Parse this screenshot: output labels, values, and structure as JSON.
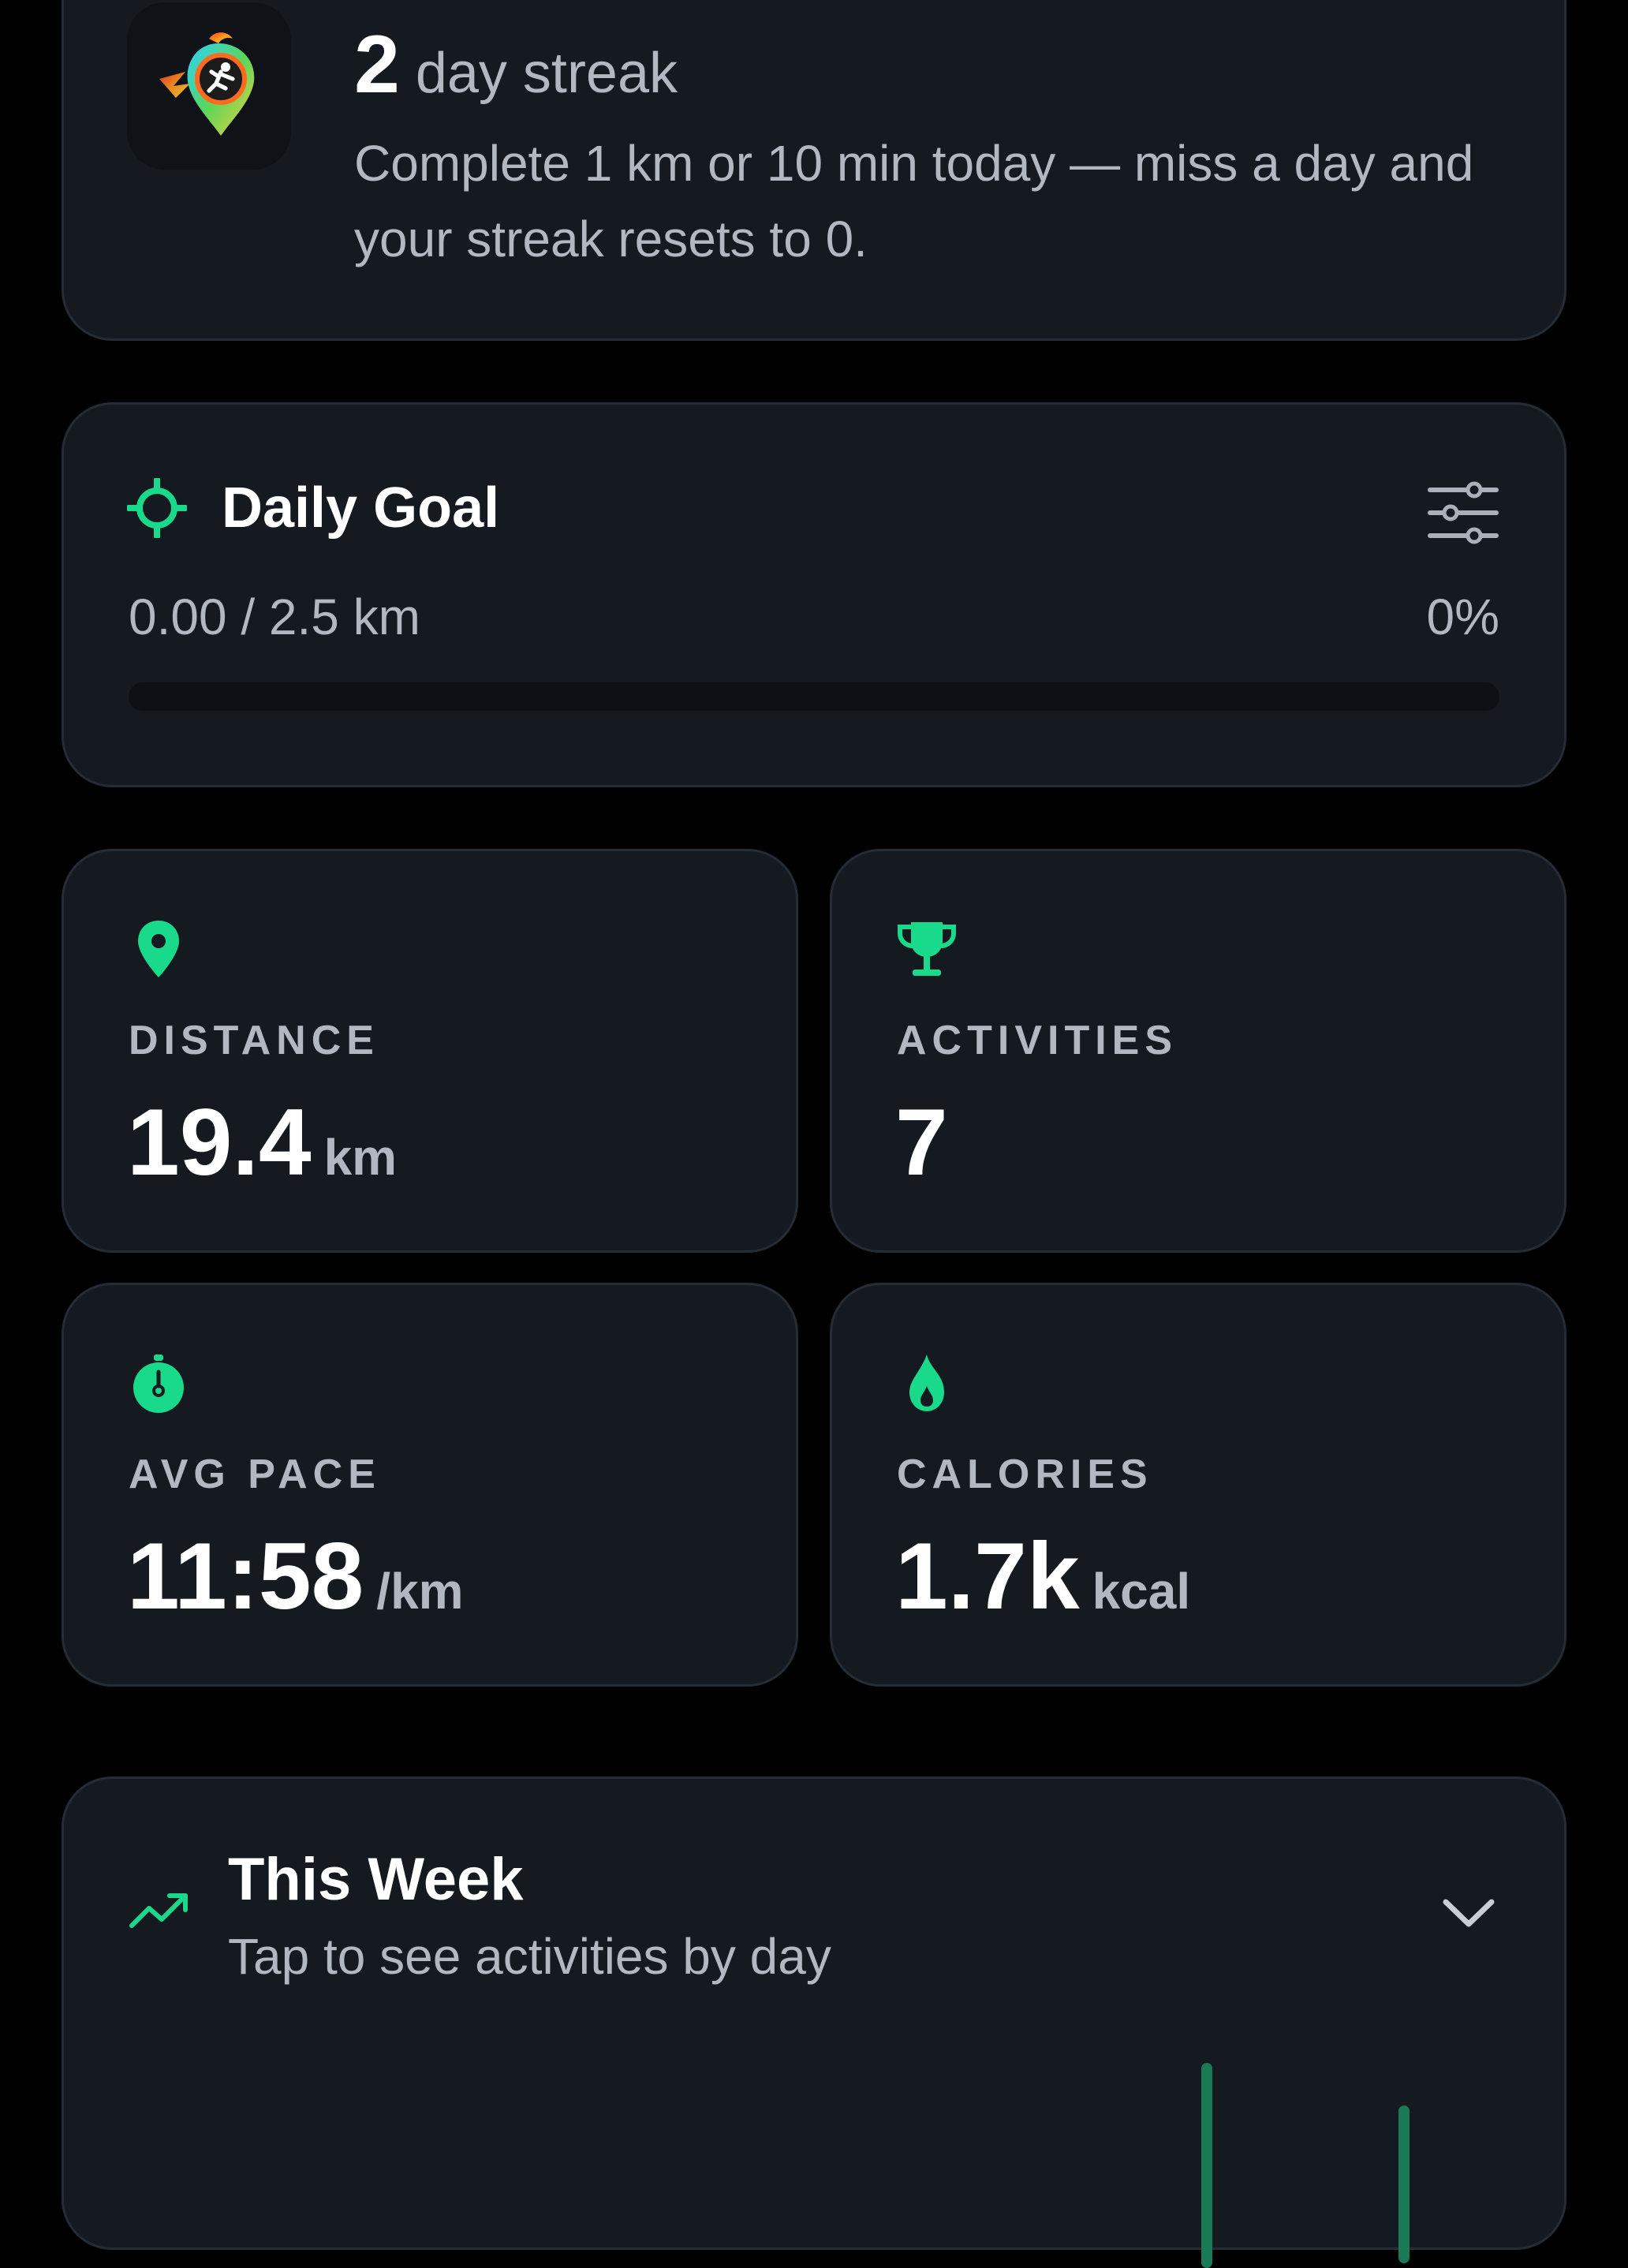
{
  "streak": {
    "count": "2",
    "unit_label": "day streak",
    "description": "Complete 1 km or 10 min today — miss a day and your streak resets to 0.",
    "icon": "flaming-runner-pin-icon"
  },
  "daily_goal": {
    "title": "Daily Goal",
    "progress_text": "0.00 / 2.5 km",
    "percent_text": "0%",
    "progress_fraction": 0,
    "icon": "target-icon",
    "settings_icon": "sliders-icon"
  },
  "stats": {
    "distance": {
      "label": "DISTANCE",
      "value": "19.4",
      "unit": "km",
      "icon": "map-pin-icon"
    },
    "activities": {
      "label": "ACTIVITIES",
      "value": "7",
      "icon": "trophy-icon"
    },
    "avg_pace": {
      "label": "AVG PACE",
      "value": "11:58",
      "unit": "/km",
      "icon": "stopwatch-icon"
    },
    "calories": {
      "label": "CALORIES",
      "value": "1.7k",
      "unit": "kcal",
      "icon": "flame-icon"
    }
  },
  "this_week": {
    "title": "This Week",
    "subtitle": "Tap to see activities by day",
    "icon": "trending-up-icon",
    "expand_icon": "chevron-down-icon"
  },
  "colors": {
    "accent": "#19d98b",
    "card_bg": "#151a21",
    "muted_text": "#b2b8c1",
    "background": "#000000"
  }
}
